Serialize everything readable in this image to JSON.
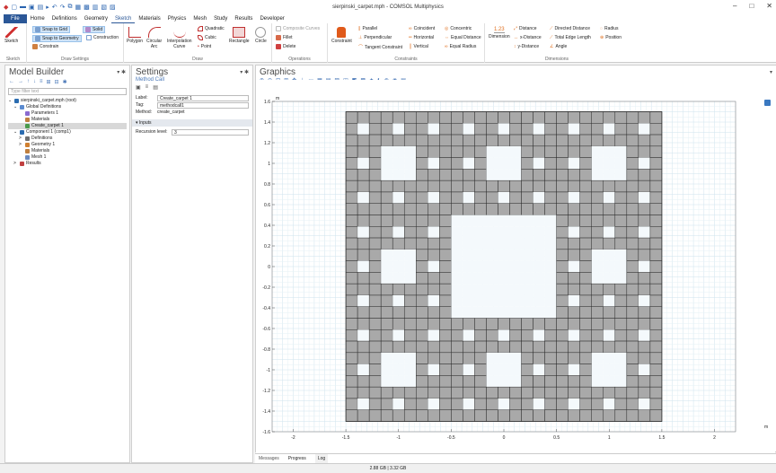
{
  "window": {
    "title": "sierpinski_carpet.mph - COMSOL Multiphysics",
    "qat_icons": [
      "new-icon",
      "open-icon",
      "save-icon",
      "print-icon",
      "run-icon",
      "undo-icon",
      "redo-icon",
      "copy-icon",
      "paste-icon",
      "duplicate-icon",
      "delete-icon",
      "build-icon",
      "windows-icon"
    ],
    "controls": [
      "–",
      "□",
      "✕"
    ]
  },
  "menu": {
    "tabs": [
      "File",
      "Home",
      "Definitions",
      "Geometry",
      "Sketch",
      "Materials",
      "Physics",
      "Mesh",
      "Study",
      "Results",
      "Developer"
    ],
    "active": "Sketch"
  },
  "ribbon": {
    "sketch": {
      "label": "Sketch",
      "group": "Sketch"
    },
    "draw_settings": {
      "snap_grid": "Snap to Grid",
      "snap_geometry": "Snap to Geometry",
      "solid": "Solid",
      "construction": "Construction",
      "constrain": "Constrain",
      "group": "Draw Settings"
    },
    "draw": {
      "polygon": "Polygon",
      "circular_arc": "Circular\nArc",
      "interpolation_curve": "Interpolation\nCurve",
      "quadratic": "Quadratic",
      "cubic": "Cubic",
      "point": "Point",
      "rectangle": "Rectangle",
      "circle": "Circle",
      "group": "Draw"
    },
    "operations": {
      "composite": "Composite Curves",
      "fillet": "Fillet",
      "delete": "Delete",
      "group": "Operations"
    },
    "constraints": {
      "constraint": "Constraint",
      "parallel": "Parallel",
      "perpendicular": "Perpendicular",
      "tangent": "Tangent Constraint",
      "coincident": "Coincident",
      "horizontal": "Horizontal",
      "vertical": "Vertical",
      "concentric": "Concentric",
      "equal_distance": "Equal Distance",
      "equal_radius": "Equal Radius",
      "group": "Constraints"
    },
    "dimensions": {
      "dimension": "Dimension",
      "dimension_value": "1.23",
      "distance": "Distance",
      "x_distance": "x-Distance",
      "y_distance": "y-Distance",
      "directed_distance": "Directed Distance",
      "total_edge_length": "Total Edge Length",
      "angle": "Angle",
      "radius": "Radius",
      "position": "Position",
      "group": "Dimensions"
    }
  },
  "model_builder": {
    "title": "Model Builder",
    "filter_placeholder": "Type filter text",
    "tree": [
      {
        "label": "sierpinski_carpet.mph (root)",
        "indent": 0,
        "icon": "root-icon",
        "color": "#2b6cb0",
        "selected": false,
        "caret": "⌄"
      },
      {
        "label": "Global Definitions",
        "indent": 1,
        "icon": "globe-icon",
        "color": "#5b8bd0",
        "selected": false,
        "caret": "⌄"
      },
      {
        "label": "Parameters 1",
        "indent": 2,
        "icon": "parameters-icon",
        "color": "#8a6bd0",
        "selected": false,
        "caret": ""
      },
      {
        "label": "Materials",
        "indent": 2,
        "icon": "materials-icon",
        "color": "#c08040",
        "selected": false,
        "caret": ""
      },
      {
        "label": "Create_carpet 1",
        "indent": 2,
        "icon": "method-call-icon",
        "color": "#4a9a4a",
        "selected": true,
        "caret": ""
      },
      {
        "label": "Component 1 (comp1)",
        "indent": 1,
        "icon": "component-icon",
        "color": "#2b6cb0",
        "selected": false,
        "caret": "⌄"
      },
      {
        "label": "Definitions",
        "indent": 2,
        "icon": "definitions-icon",
        "color": "#707070",
        "selected": false,
        "caret": ">"
      },
      {
        "label": "Geometry 1",
        "indent": 2,
        "icon": "geometry-icon",
        "color": "#d08030",
        "selected": false,
        "caret": ">"
      },
      {
        "label": "Materials",
        "indent": 2,
        "icon": "materials-icon",
        "color": "#c08040",
        "selected": false,
        "caret": ""
      },
      {
        "label": "Mesh 1",
        "indent": 2,
        "icon": "mesh-icon",
        "color": "#6a8ac0",
        "selected": false,
        "caret": ""
      },
      {
        "label": "Results",
        "indent": 1,
        "icon": "results-icon",
        "color": "#c04040",
        "selected": false,
        "caret": ">"
      }
    ]
  },
  "settings": {
    "title": "Settings",
    "subtitle": "Method Call",
    "label_label": "Label:",
    "label_value": "Create_carpet 1",
    "tag_label": "Tag:",
    "tag_value": "methodcall1",
    "method_label": "Method:",
    "method_value": "create_carpet",
    "section": "Inputs",
    "recursion_label": "Recursion level:",
    "recursion_value": "3"
  },
  "graphics": {
    "title": "Graphics",
    "unit": "m",
    "x_ticks": [
      "-2",
      "-1.5",
      "-1",
      "-0.5",
      "0",
      "0.5",
      "1",
      "1.5",
      "2"
    ],
    "y_ticks": [
      "1.6",
      "1.4",
      "1.2",
      "1",
      "0.8",
      "0.6",
      "0.4",
      "0.2",
      "0",
      "-0.2",
      "-0.4",
      "-0.6",
      "-0.8",
      "-1",
      "-1.2",
      "-1.4",
      "-1.6"
    ],
    "carpet_level": 3,
    "fill_color": "#a9a9a9",
    "hole_color": "#f4f9fc",
    "line_color": "#2b2b2b"
  },
  "bottom_tabs": [
    "Messages",
    "Progress",
    "Log"
  ],
  "status": {
    "memory": "2.88 GB | 3.32 GB"
  }
}
